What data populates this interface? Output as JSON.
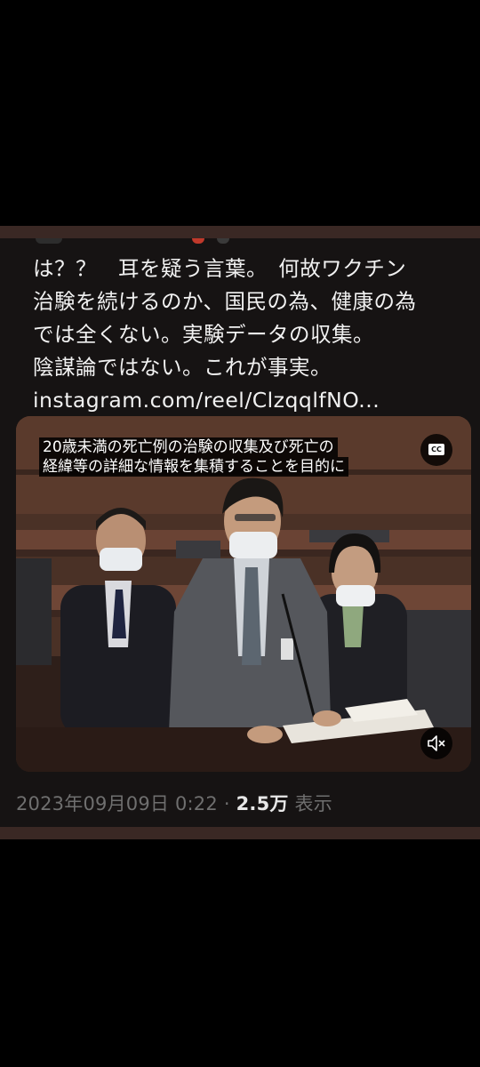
{
  "tweet": {
    "lines": [
      "は？？　耳を疑う言葉。　何故ワクチン",
      "治験を続けるのか、国民の為、健康の為",
      "では全くない。実験データの収集。",
      "陰謀論ではない。これが事実。"
    ],
    "link": "instagram.com/reel/ClzqqlfNO..."
  },
  "video": {
    "caption_line1": "20歳未満の死亡例の治験の収集及び死亡の",
    "caption_line2": "経緯等の詳細な情報を集積することを目的に",
    "cc_label": "CC",
    "cc_icon": "closed-captions-icon",
    "mute_icon": "speaker-muted-icon"
  },
  "meta": {
    "timestamp": "2023年09月09日 0:22",
    "separator": "·",
    "views_count": "2.5万",
    "views_label": "表示"
  },
  "colors": {
    "background": "#000000",
    "band": "#3a2824",
    "card": "#161313",
    "text": "#f1f1f1",
    "muted": "#6f6f6f"
  }
}
